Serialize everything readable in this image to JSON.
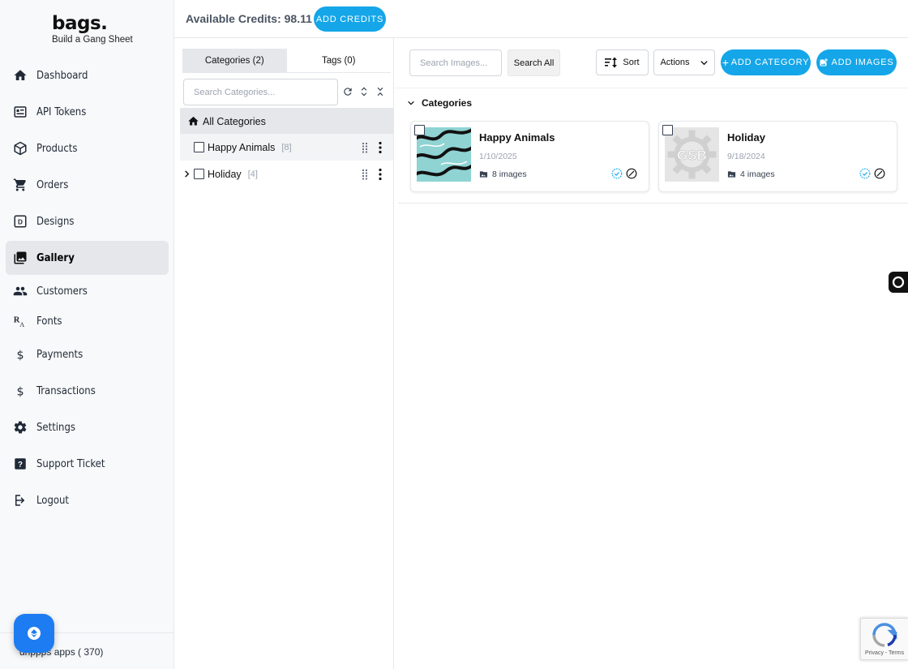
{
  "brand": {
    "name": "bags.",
    "tagline": "Build a Gang Sheet"
  },
  "topbar": {
    "credits_label": "Available Credits: 98.11",
    "add_credits": "ADD CREDITS"
  },
  "sidebar": {
    "items": [
      {
        "label": "Dashboard",
        "icon": "home-icon"
      },
      {
        "label": "API Tokens",
        "icon": "api-token-icon"
      },
      {
        "label": "Products",
        "icon": "box-icon"
      },
      {
        "label": "Orders",
        "icon": "cart-icon"
      },
      {
        "label": "Designs",
        "icon": "design-icon"
      },
      {
        "label": "Gallery",
        "icon": "image-icon",
        "active": true
      },
      {
        "label": "Customers",
        "icon": "people-icon"
      },
      {
        "label": "Fonts",
        "icon": "font-icon"
      },
      {
        "label": "Payments",
        "icon": "dollar-icon"
      },
      {
        "label": "Transactions",
        "icon": "dollar-icon"
      },
      {
        "label": "Settings",
        "icon": "gear-icon"
      },
      {
        "label": "Support Ticket",
        "icon": "help-icon"
      },
      {
        "label": "Logout",
        "icon": "logout-icon"
      }
    ],
    "footer": "drippps apps ( 370)"
  },
  "categories_panel": {
    "tabs": [
      "Categories (2)",
      "Tags (0)"
    ],
    "search_placeholder": "Search Categories...",
    "all_label": "All Categories",
    "tree": [
      {
        "label": "Happy Animals",
        "count": "[8]"
      },
      {
        "label": "Holiday",
        "count": "[4]"
      }
    ]
  },
  "main": {
    "search_placeholder": "Search Images...",
    "search_all": "Search All",
    "sort": "Sort",
    "actions": "Actions",
    "add_category": "ADD CATEGORY",
    "add_images": "ADD IMAGES",
    "section_title": "Categories",
    "cards": [
      {
        "title": "Happy Animals",
        "date": "1/10/2025",
        "count": "8 images"
      },
      {
        "title": "Holiday",
        "date": "9/18/2024",
        "count": "4 images",
        "thumb_text": "GSB"
      }
    ]
  },
  "recaptcha": {
    "text": "Privacy - Terms"
  },
  "colors": {
    "accent": "#14a6e8",
    "verified": "#22c55e",
    "fab": "#1d7cf2"
  }
}
